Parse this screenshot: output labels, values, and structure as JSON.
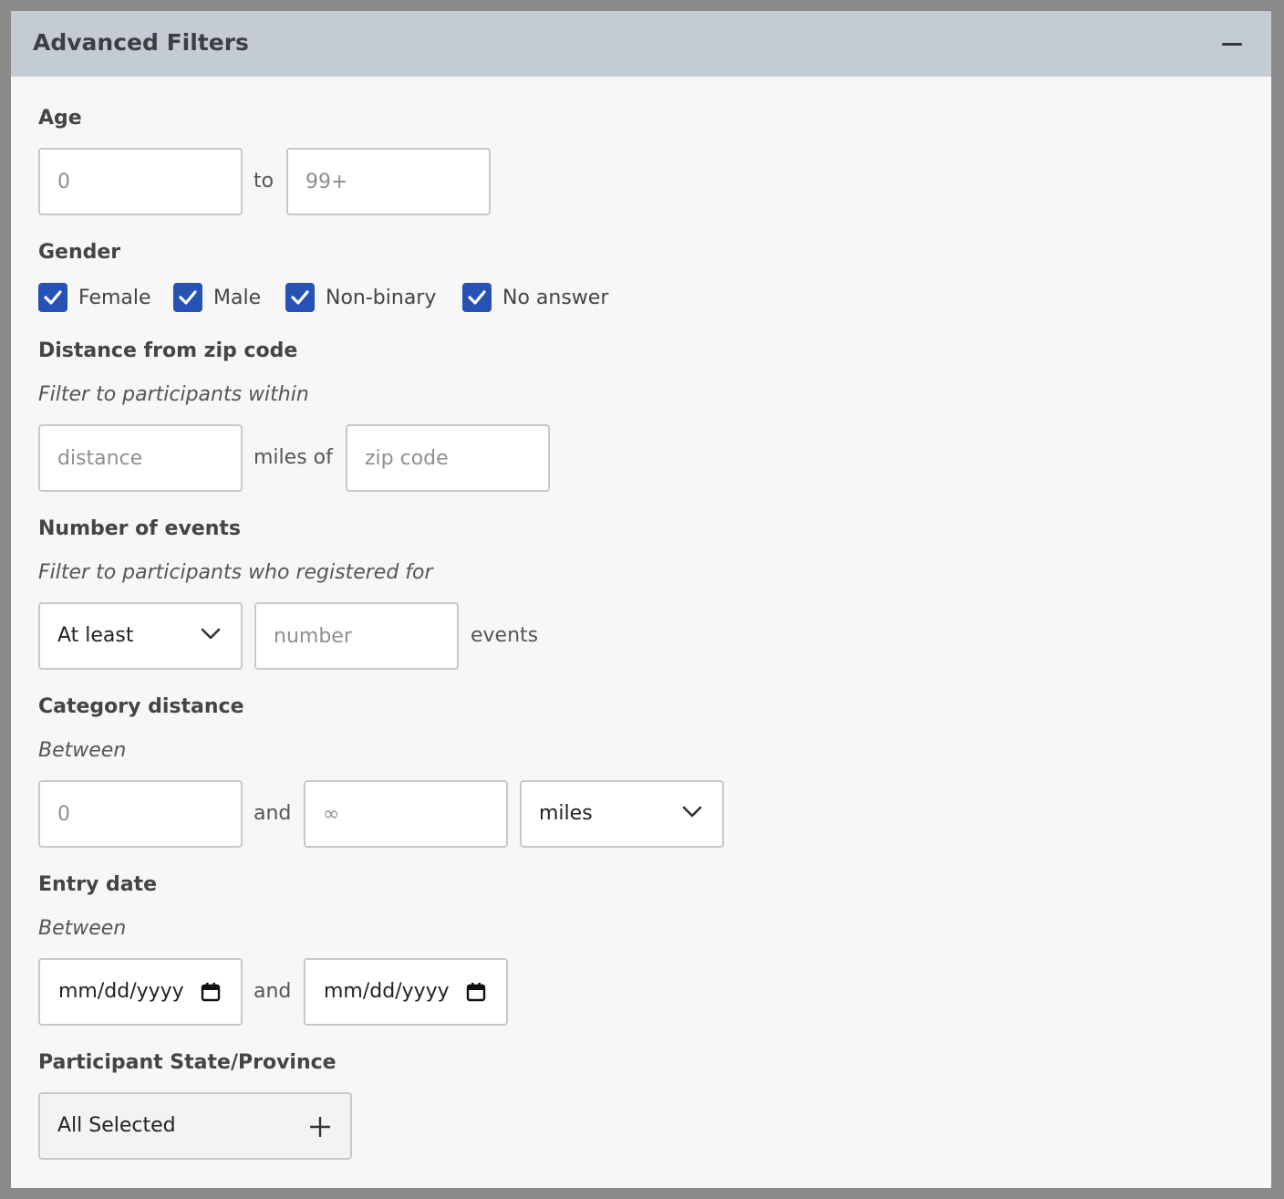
{
  "panel": {
    "title": "Advanced Filters"
  },
  "age": {
    "label": "Age",
    "min_placeholder": "0",
    "to": "to",
    "max_placeholder": "99+"
  },
  "gender": {
    "label": "Gender",
    "options": [
      {
        "label": "Female",
        "checked": true
      },
      {
        "label": "Male",
        "checked": true
      },
      {
        "label": "Non-binary",
        "checked": true
      },
      {
        "label": "No answer",
        "checked": true
      }
    ]
  },
  "zip": {
    "label": "Distance from zip code",
    "hint": "Filter to participants within",
    "distance_placeholder": "distance",
    "connector": "miles of",
    "zip_placeholder": "zip code"
  },
  "events": {
    "label": "Number of events",
    "hint": "Filter to participants who registered for",
    "comparator": "At least",
    "number_placeholder": "number",
    "suffix": "events"
  },
  "category_distance": {
    "label": "Category distance",
    "hint": "Between",
    "min_placeholder": "0",
    "connector": "and",
    "max_placeholder": "∞",
    "unit": "miles"
  },
  "entry_date": {
    "label": "Entry date",
    "hint": "Between",
    "start_placeholder": "mm/dd/yyyy",
    "connector": "and",
    "end_placeholder": "mm/dd/yyyy"
  },
  "state": {
    "label": "Participant State/Province",
    "value": "All Selected"
  },
  "colors": {
    "checkbox": "#2652b5",
    "header": "#c4cbd3"
  }
}
